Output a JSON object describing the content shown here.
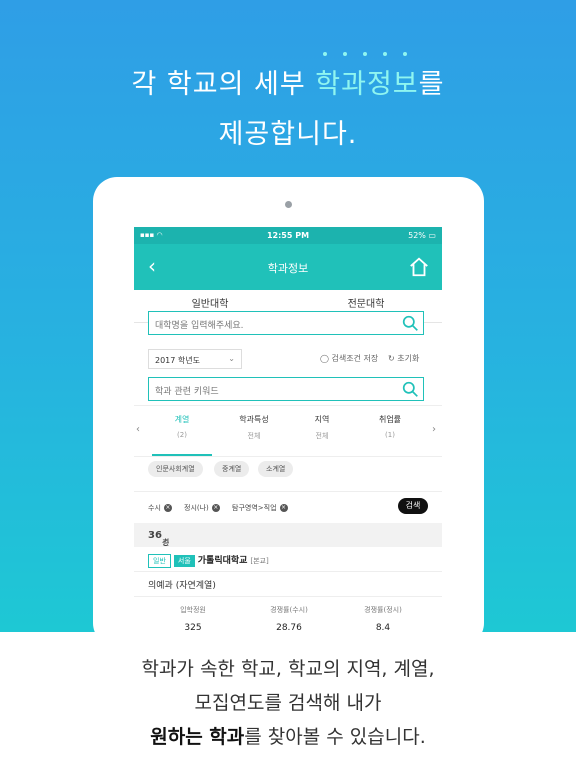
{
  "headline": {
    "line1_prefix": "각 학교의 세부 ",
    "line1_highlight": "학과정보",
    "line1_suffix": "를",
    "line2": "제공합니다."
  },
  "status": {
    "time": "12:55 PM",
    "battery": "52%"
  },
  "nav": {
    "title": "학과정보"
  },
  "tabs": [
    "일반대학",
    "전문대학"
  ],
  "search": {
    "university_placeholder": "대학명을 입력해주세요.",
    "keyword_placeholder": "학과 관련 키워드"
  },
  "year_select": {
    "value": "2017 학년도"
  },
  "options": {
    "save": "검색조건 저장",
    "reset": "초기화"
  },
  "filters": [
    {
      "label": "계열",
      "sub": "(2)"
    },
    {
      "label": "학과특성",
      "sub": "전체"
    },
    {
      "label": "지역",
      "sub": "전체"
    },
    {
      "label": "취업률",
      "sub": "(1)"
    }
  ],
  "category_chips": [
    "인문사회계열",
    "중계열",
    "소계열"
  ],
  "applied_filters": [
    "수시",
    "정시(나)",
    "탐구영역>직업"
  ],
  "search_button": "검색",
  "result": {
    "prefix": "총 ",
    "count": "36",
    "suffix": "건"
  },
  "university": {
    "tag_general": "일반",
    "tag_region": "서울",
    "name": "가톨릭대학교",
    "campus": "[본교]"
  },
  "department": "의예과 (자연계열)",
  "stats": [
    {
      "label": "입학정원",
      "value": "325"
    },
    {
      "label": "경쟁률(수시)",
      "value": "28.76"
    },
    {
      "label": "경쟁률(정시)",
      "value": "8.4"
    }
  ],
  "bottom": {
    "line1": "학과가 속한 학교, 학교의 지역, 계열,",
    "line2": "모집연도를 검색해 내가",
    "line3_bold1": "원하는 학과",
    "line3_mid": "를 찾아볼 수 있습니다."
  },
  "colors": {
    "accent": "#20c1b9",
    "highlight": "#8ff5f0"
  }
}
